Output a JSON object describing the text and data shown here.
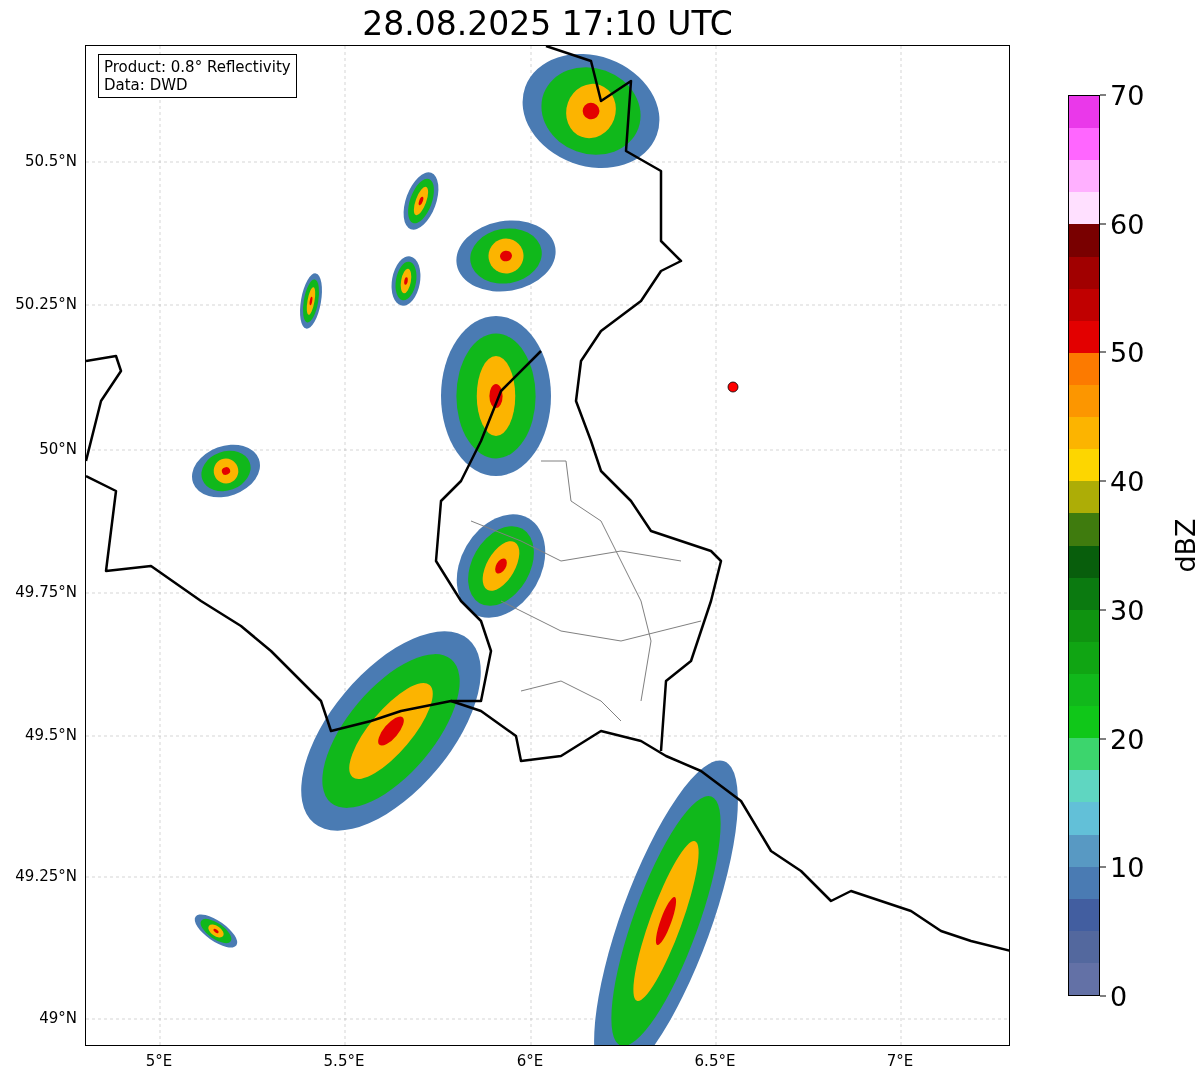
{
  "title": "28.08.2025 17:10 UTC",
  "info_box": {
    "lines": [
      "Product: 0.8° Reflectivity",
      "Data: DWD"
    ]
  },
  "y_axis": {
    "ticks": [
      "50.5°N",
      "50.25°N",
      "50°N",
      "49.75°N",
      "49.5°N",
      "49.25°N",
      "49°N"
    ]
  },
  "x_axis": {
    "ticks": [
      "5°E",
      "5.5°E",
      "6°E",
      "6.5°E",
      "7°E"
    ]
  },
  "colorbar": {
    "label": "dBZ",
    "ticks": [
      "70",
      "60",
      "50",
      "40",
      "30",
      "20",
      "10",
      "0"
    ],
    "segments": [
      {
        "color": "#ea38ea"
      },
      {
        "color": "#ff66ff"
      },
      {
        "color": "#ffb0ff"
      },
      {
        "color": "#ffe0ff"
      },
      {
        "color": "#790000"
      },
      {
        "color": "#a10000"
      },
      {
        "color": "#c00000"
      },
      {
        "color": "#e30000"
      },
      {
        "color": "#fc7a00"
      },
      {
        "color": "#fc9600"
      },
      {
        "color": "#fcb400"
      },
      {
        "color": "#fdd600"
      },
      {
        "color": "#adad06"
      },
      {
        "color": "#3f7b0e"
      },
      {
        "color": "#085e0c"
      },
      {
        "color": "#0b7a10"
      },
      {
        "color": "#0f9310"
      },
      {
        "color": "#10a513"
      },
      {
        "color": "#11b81b"
      },
      {
        "color": "#10c719"
      },
      {
        "color": "#3cd56d"
      },
      {
        "color": "#5fd6c1"
      },
      {
        "color": "#62c0d8"
      },
      {
        "color": "#5899c3"
      },
      {
        "color": "#4a7bb3"
      },
      {
        "color": "#425ea0"
      },
      {
        "color": "#53689e"
      },
      {
        "color": "#6371a6"
      }
    ]
  }
}
